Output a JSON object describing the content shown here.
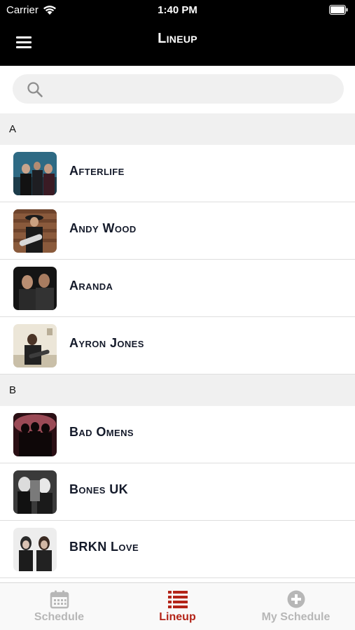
{
  "status_bar": {
    "carrier": "Carrier",
    "time": "1:40 PM"
  },
  "header": {
    "title": "Lineup"
  },
  "search": {
    "placeholder": ""
  },
  "sections": [
    {
      "letter": "A",
      "artists": [
        "Afterlife",
        "Andy Wood",
        "Aranda",
        "Ayron Jones"
      ]
    },
    {
      "letter": "B",
      "artists": [
        "Bad Omens",
        "Bones UK",
        "BRKN Love"
      ]
    }
  ],
  "tabs": [
    {
      "label": "Schedule",
      "icon": "calendar-icon",
      "active": false
    },
    {
      "label": "Lineup",
      "icon": "list-icon",
      "active": true
    },
    {
      "label": "My Schedule",
      "icon": "plus-circle-icon",
      "active": false
    }
  ],
  "colors": {
    "header_bg": "#000000",
    "accent": "#b32418",
    "inactive": "#b7b7b7",
    "artist_text": "#141a2a",
    "section_bg": "#f0f0f0"
  }
}
